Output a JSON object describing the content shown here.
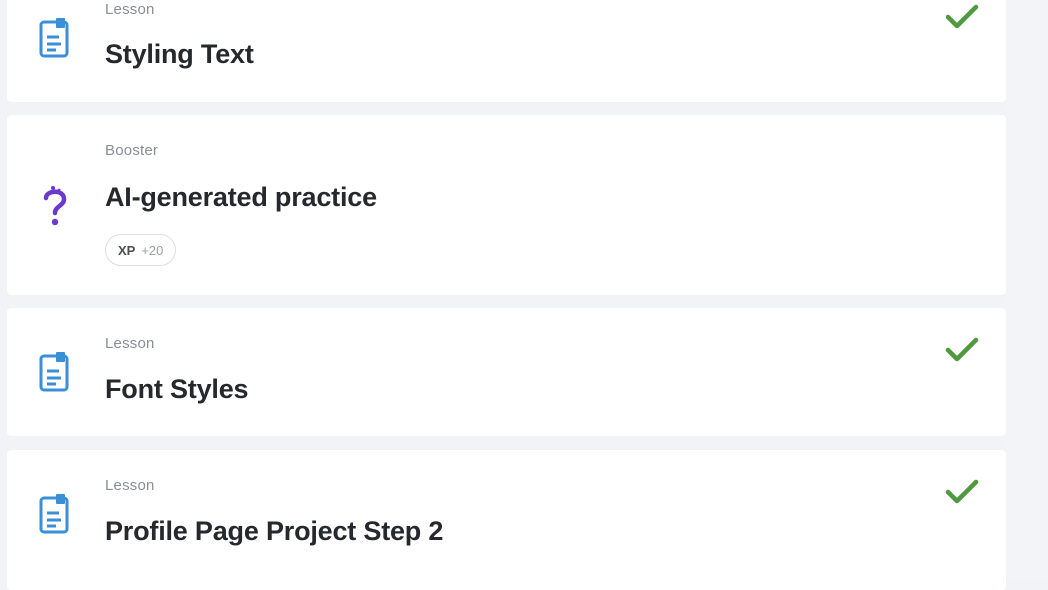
{
  "colors": {
    "page_background": "#f1f3f6",
    "card_background": "#ffffff",
    "lesson_icon": "#3a8fd6",
    "booster_icon": "#6a3ad0",
    "check": "#4f9a3c",
    "title_text": "#25282d",
    "type_text": "#8a8f96"
  },
  "items": [
    {
      "type": "Lesson",
      "title": "Styling Text",
      "icon": "lesson-document-icon",
      "completed": true
    },
    {
      "type": "Booster",
      "title": "AI-generated practice",
      "icon": "question-mark-icon",
      "completed": false,
      "badge": {
        "label": "XP",
        "value": "+20"
      }
    },
    {
      "type": "Lesson",
      "title": "Font Styles",
      "icon": "lesson-document-icon",
      "completed": true
    },
    {
      "type": "Lesson",
      "title": "Profile Page Project Step 2",
      "icon": "lesson-document-icon",
      "completed": true
    }
  ]
}
